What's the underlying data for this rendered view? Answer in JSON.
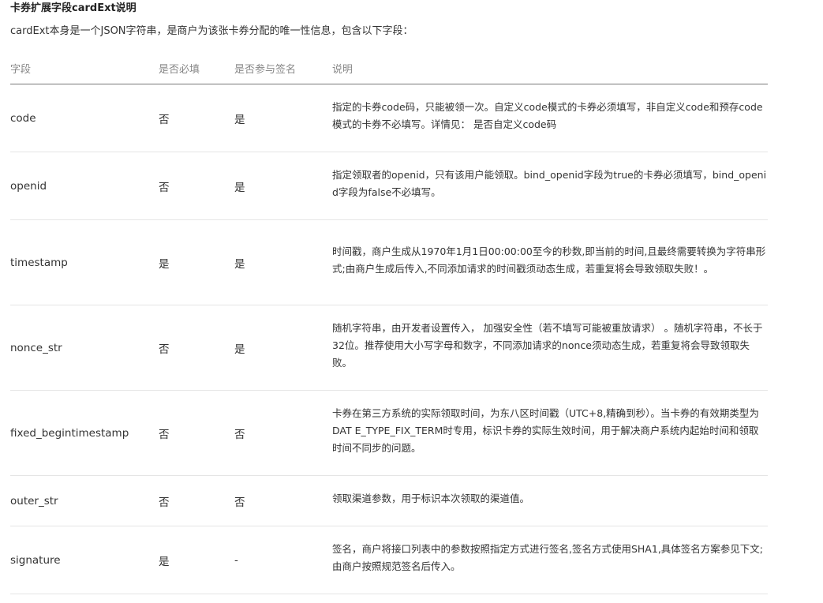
{
  "heading": "卡券扩展字段cardExt说明",
  "intro": "cardExt本身是一个JSON字符串，是商户为该张卡券分配的唯一性信息，包含以下字段：",
  "table": {
    "headers": [
      "字段",
      "是否必填",
      "是否参与签名",
      "说明"
    ],
    "rows": [
      {
        "field": "code",
        "required": "否",
        "signed": "是",
        "desc": "指定的卡券code码，只能被领一次。自定义code模式的卡券必须填写，非自定义code和预存code模式的卡券不必填写。详情见： 是否自定义code码"
      },
      {
        "field": "openid",
        "required": "否",
        "signed": "是",
        "desc": "指定领取者的openid，只有该用户能领取。bind_openid字段为true的卡券必须填写，bind_openid字段为false不必填写。"
      },
      {
        "field": "timestamp",
        "required": "是",
        "signed": "是",
        "desc": "时间戳，商户生成从1970年1月1日00:00:00至今的秒数,即当前的时间,且最终需要转换为字符串形式;由商户生成后传入,不同添加请求的时间戳须动态生成，若重复将会导致领取失败！。"
      },
      {
        "field": "nonce_str",
        "required": "否",
        "signed": "是",
        "desc": "随机字符串，由开发者设置传入， 加强安全性（若不填写可能被重放请求） 。随机字符串，不长于32位。推荐使用大小写字母和数字，不同添加请求的nonce须动态生成，若重复将会导致领取失败。"
      },
      {
        "field": "fixed_begintimestamp",
        "required": "否",
        "signed": "否",
        "desc": "卡券在第三方系统的实际领取时间，为东八区时间戳（UTC+8,精确到秒）。当卡券的有效期类型为 DAT E_TYPE_FIX_TERM时专用，标识卡券的实际生效时间，用于解决商户系统内起始时间和领取时间不同步的问题。"
      },
      {
        "field": "outer_str",
        "required": "否",
        "signed": "否",
        "desc": "领取渠道参数，用于标识本次领取的渠道值。"
      },
      {
        "field": "signature",
        "required": "是",
        "signed": "-",
        "desc": "签名，商户将接口列表中的参数按照指定方式进行签名,签名方式使用SHA1,具体签名方案参见下文;由商户按照规范签名后传入。"
      }
    ]
  }
}
